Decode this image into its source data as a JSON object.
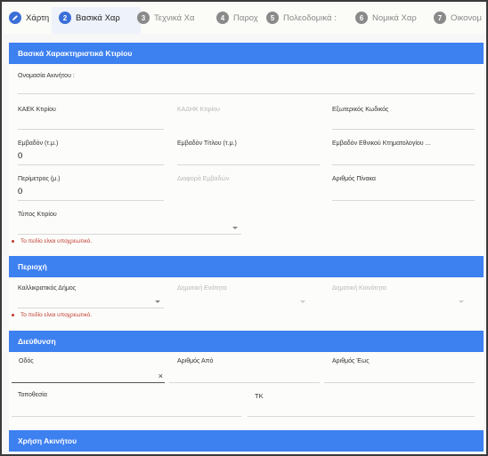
{
  "stepper": {
    "steps": [
      {
        "num": "",
        "label": "Χάρτη",
        "state": "done"
      },
      {
        "num": "2",
        "label": "Βασικά Χαρ",
        "state": "active"
      },
      {
        "num": "3",
        "label": "Τεχνικά Χα",
        "state": "inactive"
      },
      {
        "num": "4",
        "label": "Παροχ",
        "state": "inactive"
      },
      {
        "num": "5",
        "label": "Πολεοδομικά :",
        "state": "inactive"
      },
      {
        "num": "6",
        "label": "Νομικά Χαρ",
        "state": "inactive"
      },
      {
        "num": "7",
        "label": "Οικονομ",
        "state": "inactive"
      }
    ]
  },
  "sections": {
    "basic": "Βασικά Χαρακτηριστικά Κτιρίου",
    "area": "Περιοχή",
    "address": "Διεύθυνση",
    "usage": "Χρήση Ακινήτου"
  },
  "basic": {
    "property_name": {
      "label": "Ονομασία Ακινήτου :",
      "value": ""
    },
    "kaek": {
      "label": "ΚΑΕΚ Κτιρίου",
      "value": ""
    },
    "kadik": {
      "label": "ΚΑΔΗΚ Κτιρίου",
      "value": ""
    },
    "external_code": {
      "label": "Εξωτερικός Κωδικός",
      "value": ""
    },
    "area_sqm": {
      "label": "Εμβαδόν (τ.μ.)",
      "value": "0"
    },
    "title_area": {
      "label": "Εμβαδόν Τίτλου (τ.μ.)",
      "value": ""
    },
    "cadastre_area": {
      "label": "Εμβαδόν Εθνικού Κτηματολογίου ...",
      "value": ""
    },
    "perimeter": {
      "label": "Περίμετρος (μ.)",
      "value": "0"
    },
    "area_diff": {
      "label": "Διαφορά Εμβαδών",
      "value": ""
    },
    "table_number": {
      "label": "Αριθμός Πίνακα",
      "value": ""
    },
    "building_type": {
      "label": "Τύπος Κτιρίου",
      "value": ""
    },
    "error": "Το πεδίο είναι υποχρεωτικό."
  },
  "area": {
    "municipality": {
      "label": "Καλλικρατικός Δήμος",
      "value": ""
    },
    "municipal_unit": {
      "label": "Δημοτική Ενότητα",
      "value": ""
    },
    "municipal_community": {
      "label": "Δημοτική Κοινότητα",
      "value": ""
    },
    "error": "Το πεδίο είναι υποχρεωτικό."
  },
  "address": {
    "street": {
      "label": "Οδός",
      "value": "",
      "clear_icon": "×"
    },
    "number_from": {
      "label": "Αριθμός Από",
      "value": ""
    },
    "number_to": {
      "label": "Αριθμός Έως",
      "value": ""
    },
    "location": {
      "label": "Τοποθεσία",
      "value": ""
    },
    "postal_code": {
      "label": "ΤΚ",
      "value": ""
    }
  }
}
